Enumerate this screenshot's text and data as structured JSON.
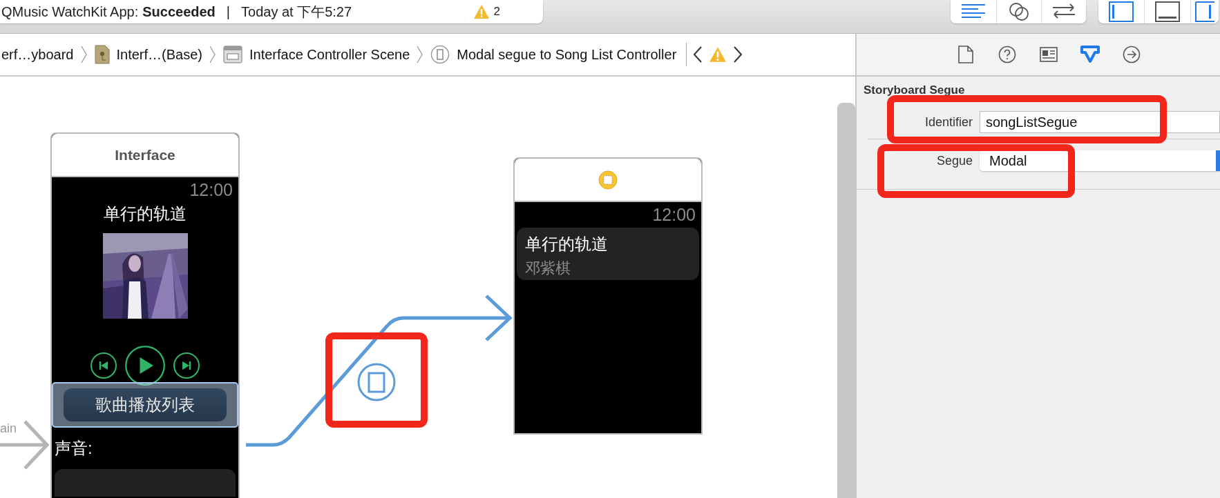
{
  "status": {
    "project": "QMusic WatchKit App:",
    "result": "Succeeded",
    "separator": "|",
    "time": "Today at 下午5:27",
    "warnings": "2"
  },
  "editor_modes": [
    {
      "selected": true
    },
    {
      "selected": false
    },
    {
      "selected": false
    }
  ],
  "panel_toggles": [
    {
      "on": true
    },
    {
      "on": false
    },
    {
      "on": true
    }
  ],
  "breadcrumbs": [
    {
      "kind": "plain",
      "label": "erf…yboard"
    },
    {
      "kind": "storyboard",
      "label": "Interf…(Base)"
    },
    {
      "kind": "scene",
      "label": "Interface Controller Scene"
    },
    {
      "kind": "segue",
      "label": "Modal segue to Song List Controller"
    }
  ],
  "inspector_tabs": [
    {
      "selected": false
    },
    {
      "selected": false
    },
    {
      "selected": false
    },
    {
      "selected": true
    },
    {
      "selected": false
    }
  ],
  "inspector": {
    "section": "Storyboard Segue",
    "fields": [
      {
        "kind": "text",
        "label": "Identifier",
        "value": "songListSegue"
      },
      {
        "kind": "popup",
        "label": "Segue",
        "value": "Modal"
      }
    ]
  },
  "canvas": {
    "entry_label": "ain",
    "interface_scene": {
      "title": "Interface",
      "time": "12:00",
      "song": "单行的轨道",
      "playlist_button": {
        "label": "歌曲播放列表",
        "selected": true
      },
      "volume_label": "声音:"
    },
    "list_scene": {
      "time": "12:00",
      "rows": [
        {
          "title": "单行的轨道",
          "subtitle": "邓紫棋"
        }
      ]
    }
  }
}
